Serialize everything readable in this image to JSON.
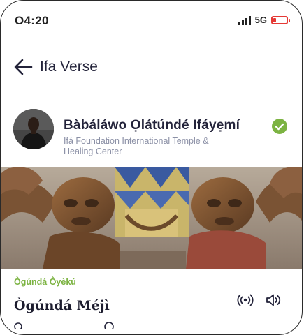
{
  "status_bar": {
    "time": "O4:20",
    "network": "5G",
    "battery_level": 0.2,
    "battery_color": "#e53935"
  },
  "header": {
    "title": "Ifa Verse",
    "back_icon": "arrow-left-icon"
  },
  "author": {
    "name": "Bàbáláwo Ọlátúndé Ifáyẹmí",
    "organization": "Ifá Foundation International Temple & Healing Center",
    "verified_icon": "check-circle-icon",
    "verified_color": "#7cb342"
  },
  "verse": {
    "subtitle": "Ògúndá Òyèkú",
    "title": "Ògúndá Méjì",
    "subtitle_color": "#7cb342",
    "actions": [
      "broadcast-icon",
      "speaker-icon"
    ]
  }
}
